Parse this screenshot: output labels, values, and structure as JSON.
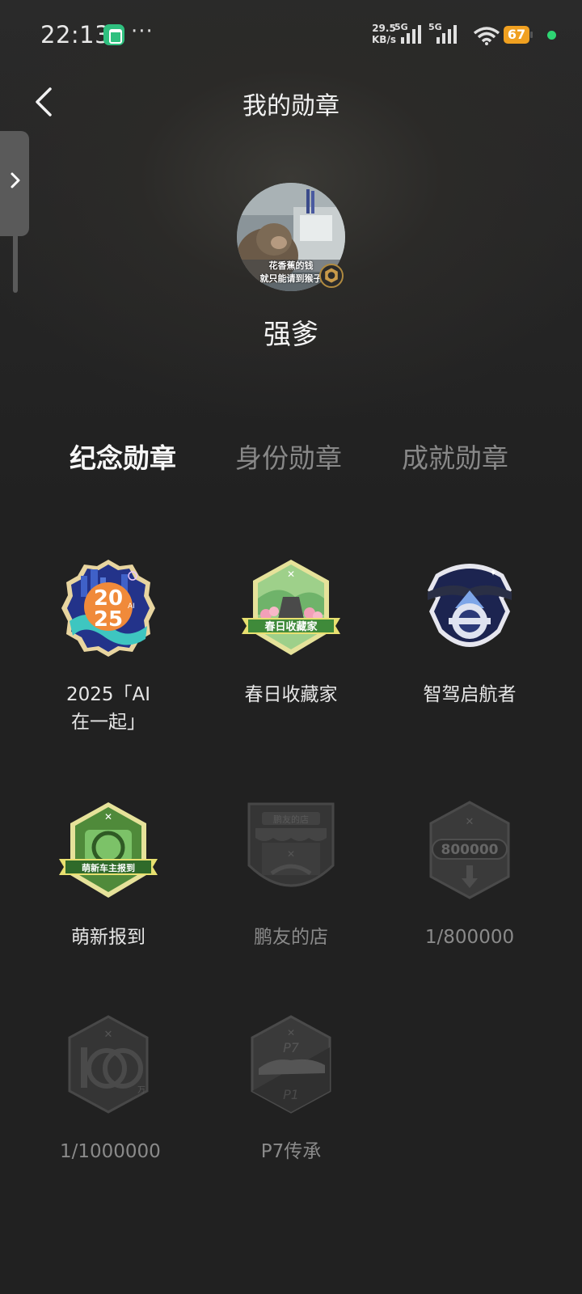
{
  "status_bar": {
    "time": "22:13",
    "more": "···",
    "net_speed_value": "29.5",
    "net_speed_unit": "KB/s",
    "sim1_label": "5G",
    "sim2_label": "5G",
    "battery": "67"
  },
  "header": {
    "title": "我的勋章"
  },
  "profile": {
    "avatar_caption_line1": "花香蕉的钱",
    "avatar_caption_line2": "就只能请到猴子",
    "name": "强爹"
  },
  "tabs": [
    {
      "label": "纪念勋章",
      "active": true
    },
    {
      "label": "身份勋章",
      "active": false
    },
    {
      "label": "成就勋章",
      "active": false
    }
  ],
  "medals": [
    {
      "label": "2025「AI在一起」",
      "locked": false,
      "icon": "year-2025-ai-medal"
    },
    {
      "label": "春日收藏家",
      "locked": false,
      "icon": "spring-collector-medal",
      "ribbon_text": "春日收藏家"
    },
    {
      "label": "智驾启航者",
      "locked": false,
      "icon": "autopilot-pioneer-medal"
    },
    {
      "label": "萌新报到",
      "locked": false,
      "icon": "newbie-checkin-medal",
      "ribbon_text": "萌新车主报到"
    },
    {
      "label": "鹏友的店",
      "locked": true,
      "icon": "pengyou-store-medal",
      "sign_text": "鹏友的店"
    },
    {
      "label": "1/800000",
      "locked": true,
      "icon": "800000-medal",
      "badge_text": "800000"
    },
    {
      "label": "1/1000000",
      "locked": true,
      "icon": "million-medal"
    },
    {
      "label": "P7传承",
      "locked": true,
      "icon": "p7-legacy-medal"
    }
  ]
}
